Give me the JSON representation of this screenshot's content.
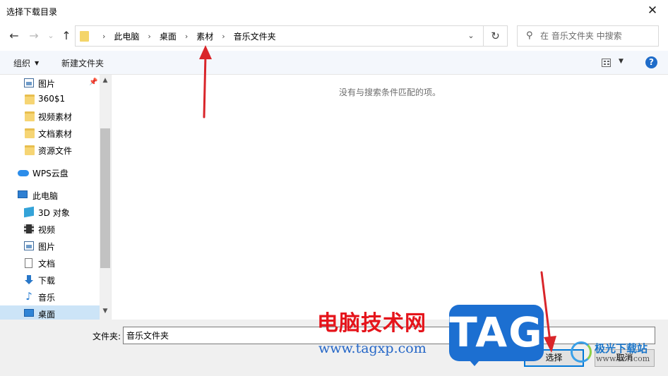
{
  "window": {
    "title": "选择下载目录",
    "close_glyph": "✕"
  },
  "nav": {
    "back_glyph": "←",
    "forward_glyph": "→",
    "recent_glyph": "⌄",
    "up_glyph": "↑",
    "refresh_glyph": "↻",
    "address_dropdown_glyph": "⌄",
    "breadcrumb_separator": "›",
    "breadcrumbs": [
      "此电脑",
      "桌面",
      "素材",
      "音乐文件夹"
    ]
  },
  "search": {
    "placeholder": "在 音乐文件夹 中搜索",
    "icon": "search-icon",
    "icon_glyph": "⚲"
  },
  "toolbar": {
    "organize_label": "组织",
    "organize_caret": "▼",
    "new_folder_label": "新建文件夹",
    "view_caret": "▼",
    "help_glyph": "?"
  },
  "sidebar": {
    "pin_glyph": "📌",
    "items": [
      {
        "label": "图片",
        "icon": "pictures-icon",
        "pinned": true
      },
      {
        "label": "360$1",
        "icon": "folder-icon"
      },
      {
        "label": "视频素材",
        "icon": "folder-icon"
      },
      {
        "label": "文档素材",
        "icon": "folder-icon"
      },
      {
        "label": "资源文件",
        "icon": "folder-icon"
      },
      {
        "label": "WPS云盘",
        "icon": "cloud-icon"
      },
      {
        "label": "此电脑",
        "icon": "computer-icon"
      },
      {
        "label": "3D 对象",
        "icon": "3d-objects-icon"
      },
      {
        "label": "视频",
        "icon": "videos-icon"
      },
      {
        "label": "图片",
        "icon": "pictures-icon"
      },
      {
        "label": "文档",
        "icon": "documents-icon"
      },
      {
        "label": "下载",
        "icon": "downloads-icon"
      },
      {
        "label": "音乐",
        "icon": "music-icon",
        "glyph": "♪"
      },
      {
        "label": "桌面",
        "icon": "desktop-icon",
        "selected": true
      }
    ],
    "scroll_up_glyph": "▲",
    "scroll_down_glyph": "▼"
  },
  "content": {
    "empty_message": "没有与搜索条件匹配的项。"
  },
  "footer": {
    "folder_label": "文件夹:",
    "folder_value": "音乐文件夹",
    "select_button": "选择",
    "cancel_button": "取消"
  },
  "watermark": {
    "cn_text": "电脑技术网",
    "url_text": "www.tagxp.com",
    "tag_text": "TAG",
    "site_name": "极光下载站",
    "site_url": "www.xz7.com"
  },
  "colors": {
    "accent": "#0078d7",
    "selection": "#cce4f7",
    "toolbar_bg": "#f4f7fc",
    "footer_bg": "#f0f0f0",
    "annotation_red": "#d9252a",
    "watermark_red": "#e5141b",
    "tag_blue": "#1c6fd1"
  }
}
